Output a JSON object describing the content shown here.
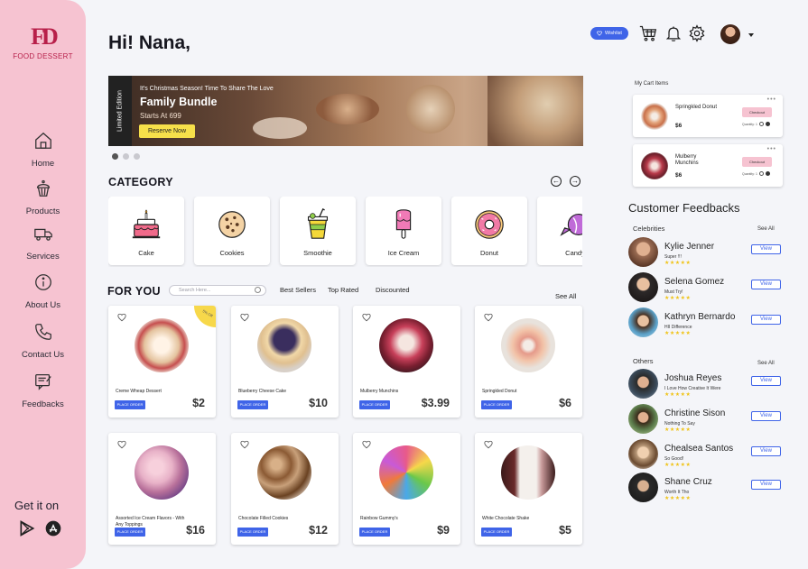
{
  "brand": {
    "name": "FOOD DESSERT",
    "logo_mark": "FD",
    "accent": "#b8204a",
    "sidebar_color": "#f6c3d1",
    "primary": "#3f64e8"
  },
  "nav": [
    {
      "label": "Home",
      "icon": "home-icon"
    },
    {
      "label": "Products",
      "icon": "cupcake-icon"
    },
    {
      "label": "Services",
      "icon": "truck-icon"
    },
    {
      "label": "About Us",
      "icon": "info-icon"
    },
    {
      "label": "Contact Us",
      "icon": "phone-icon"
    },
    {
      "label": "Feedbacks",
      "icon": "feedback-icon"
    }
  ],
  "get_it_on": "Get it on",
  "header": {
    "greeting": "Hi! Nana,",
    "wishlist": "Wishlist"
  },
  "banner": {
    "tag": "Limited Edition",
    "subtitle": "It's Christmas Season! Time To Share The Love",
    "title": "Family Bundle",
    "price": "Starts At 699",
    "button": "Reserve Now"
  },
  "category": {
    "title": "CATEGORY",
    "items": [
      {
        "label": "Cake",
        "icon": "cake-icon"
      },
      {
        "label": "Cookies",
        "icon": "cookie-icon"
      },
      {
        "label": "Smoothie",
        "icon": "smoothie-icon"
      },
      {
        "label": "Ice Cream",
        "icon": "ice-cream-icon"
      },
      {
        "label": "Donut",
        "icon": "donut-icon"
      },
      {
        "label": "Candy",
        "icon": "candy-icon"
      }
    ]
  },
  "for_you": {
    "title": "FOR YOU",
    "search_placeholder": "Search Here...",
    "filters": [
      "Best Sellers",
      "Top Rated",
      "Discounted"
    ],
    "see_all": "See All",
    "discount_badge": "5% Off",
    "order_label": "PLACE ORDER",
    "products": [
      {
        "name": "Creme Wheap Dessert",
        "price": "$2",
        "color": "#e9d6c3"
      },
      {
        "name": "Blueberry Cheese Cake",
        "price": "$10",
        "color": "#4b3a6e"
      },
      {
        "name": "Mulberry Munchins",
        "price": "$3.99",
        "color": "#c8405a"
      },
      {
        "name": "Springkled Donut",
        "price": "$6",
        "color": "#e59a8a"
      },
      {
        "name": "Assorted Ice Cream Flavors - With Any Toppings",
        "price": "$16",
        "color": "#e8b2c8"
      },
      {
        "name": "Chocolate Filled Cookies",
        "price": "$12",
        "color": "#8b5a34"
      },
      {
        "name": "Rainbow Gummy's",
        "price": "$9",
        "color": "#e85a8a"
      },
      {
        "name": "White Chocolate Shake",
        "price": "$5",
        "color": "#c89a9a"
      }
    ]
  },
  "cart": {
    "title": "My Cart Items",
    "checkout": "Checkout",
    "qty_label": "Quantity: 1",
    "items": [
      {
        "name": "Springkled Donut",
        "price": "$6",
        "color": "#e3a37a"
      },
      {
        "name": "Mulberry Munchins",
        "price": "$6",
        "color": "#b83a4a"
      }
    ]
  },
  "feedbacks": {
    "title": "Customer Feedbacks",
    "see_all": "See All",
    "view_label": "View",
    "stars": "★★★★★",
    "celebrities_label": "Celebrities",
    "others_label": "Others",
    "celebrities": [
      {
        "name": "Kylie Jenner",
        "msg": "Super !!!",
        "color": "#9a6b52"
      },
      {
        "name": "Selena Gomez",
        "msg": "Must Try!",
        "color": "#2e2a2a"
      },
      {
        "name": "Kathryn Bernardo",
        "msg": "HII Difference",
        "color": "#5aa0c8"
      }
    ],
    "others": [
      {
        "name": "Joshua Reyes",
        "msg": "I Love How Creative It Were",
        "color": "#3a4a5a"
      },
      {
        "name": "Christine Sison",
        "msg": "Nothing To Say",
        "color": "#5a7a4a"
      },
      {
        "name": "Chealsea Santos",
        "msg": "So Good!",
        "color": "#b89878"
      },
      {
        "name": "Shane Cruz",
        "msg": "Worth It Tho",
        "color": "#2a2a2a"
      }
    ]
  }
}
